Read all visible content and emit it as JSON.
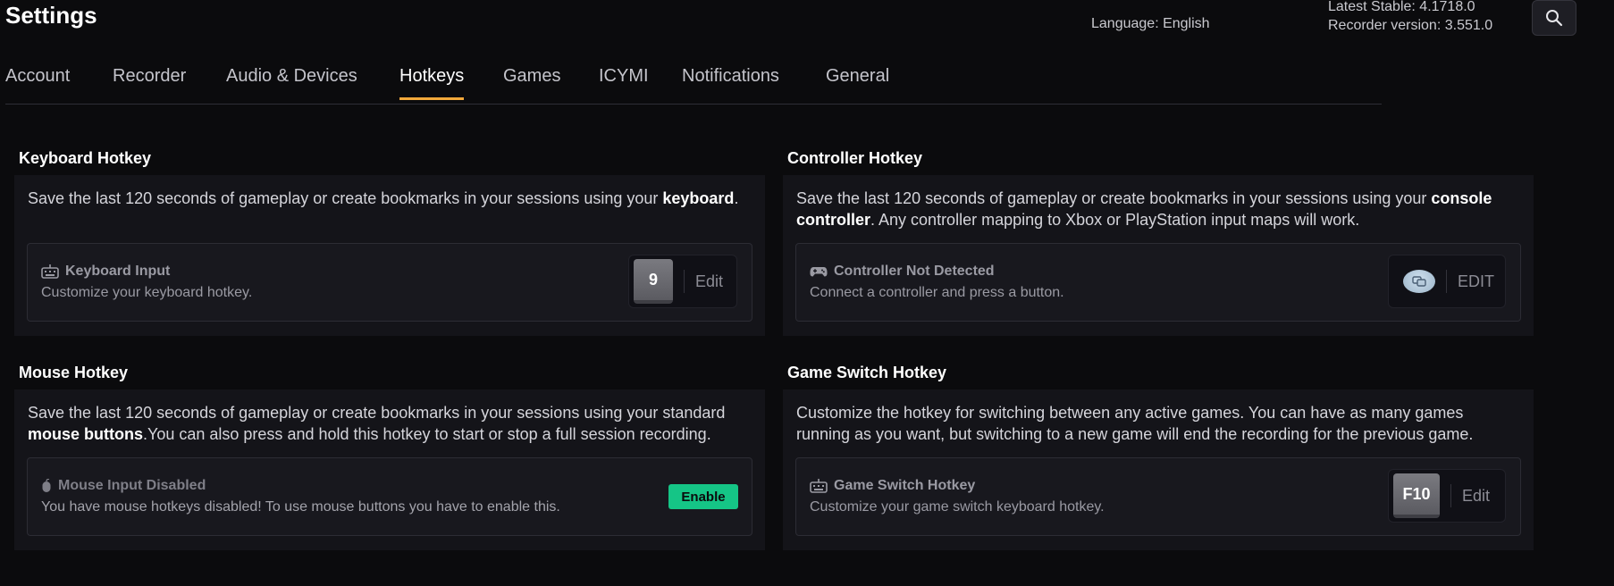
{
  "header": {
    "title": "Settings",
    "language": "Language: English",
    "latest_stable": "Latest Stable: 4.1718.0",
    "recorder_version": "Recorder version: 3.551.0"
  },
  "tabs": [
    {
      "label": "Account"
    },
    {
      "label": "Recorder"
    },
    {
      "label": "Audio & Devices"
    },
    {
      "label": "Hotkeys",
      "active": true
    },
    {
      "label": "Games"
    },
    {
      "label": "ICYMI"
    },
    {
      "label": "Notifications"
    },
    {
      "label": "General"
    }
  ],
  "keyboard": {
    "title": "Keyboard Hotkey",
    "desc_pre": "Save the last 120 seconds of gameplay or create bookmarks in your sessions using your ",
    "desc_bold": "keyboard",
    "desc_post": ".",
    "card_title": "Keyboard Input",
    "card_sub": "Customize your keyboard hotkey.",
    "key": "9",
    "edit": "Edit"
  },
  "controller": {
    "title": "Controller Hotkey",
    "desc_pre": "Save the last 120 seconds of gameplay or create bookmarks in your sessions using your ",
    "desc_bold": "console controller",
    "desc_post": ". Any controller mapping to Xbox or PlayStation input maps will work.",
    "card_title": "Controller Not Detected",
    "card_sub": "Connect a controller and press a button.",
    "edit": "EDIT"
  },
  "mouse": {
    "title": "Mouse Hotkey",
    "desc_pre": "Save the last 120 seconds of gameplay or create bookmarks in your sessions using your standard ",
    "desc_bold": "mouse buttons",
    "desc_post": ".You can also press and hold this hotkey to start or stop a full session recording.",
    "card_title": "Mouse Input Disabled",
    "card_sub": "You have mouse hotkeys disabled! To use mouse buttons you have to enable this.",
    "enable": "Enable"
  },
  "game_switch": {
    "title": "Game Switch Hotkey",
    "desc": "Customize the hotkey for switching between any active games. You can have as many games running as you want, but switching to a new game will end the recording for the previous game.",
    "card_title": "Game Switch Hotkey",
    "card_sub": "Customize your game switch keyboard hotkey.",
    "key": "F10",
    "edit": "Edit"
  },
  "colors": {
    "accent": "#f2a93b",
    "enable_green": "#15c586",
    "background": "#0b0b0d",
    "panel": "#141419"
  }
}
